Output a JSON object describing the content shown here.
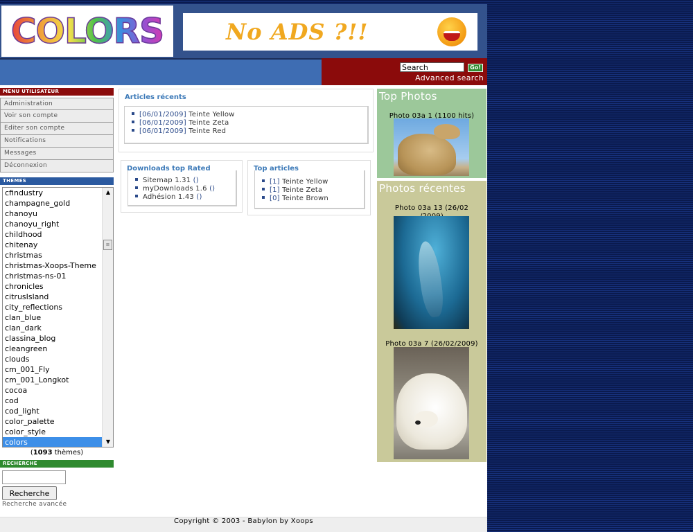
{
  "header": {
    "logo_text": "COLORS",
    "banner_text": "No ADS ?!!",
    "search_value": "Search",
    "go_label": "Go!",
    "advanced_search": "Advanced search"
  },
  "user_menu": {
    "title": "MENU UTILISATEUR",
    "items": [
      "Administration",
      "Voir son compte",
      "Editer son compte",
      "Notifications",
      "Messages",
      "Déconnexion"
    ]
  },
  "themes": {
    "title": "THEMES",
    "items": [
      "cfindustry",
      "champagne_gold",
      "chanoyu",
      "chanoyu_right",
      "childhood",
      "chitenay",
      "christmas",
      "christmas-Xoops-Theme",
      "christmas-ns-01",
      "chronicles",
      "citrusIsland",
      "city_reflections",
      "clan_blue",
      "clan_dark",
      "classina_blog",
      "cleangreen",
      "clouds",
      "cm_001_Fly",
      "cm_001_Longkot",
      "cocoa",
      "cod",
      "cod_light",
      "color_palette",
      "color_style",
      "colors"
    ],
    "selected": "colors",
    "count_prefix": "(",
    "count": "1093",
    "count_suffix": " thèmes)"
  },
  "search_block": {
    "title": "RECHERCHE",
    "button_label": "Recherche",
    "advanced_link": "Recherche avancée"
  },
  "recent_articles": {
    "title": "Articles récents",
    "items": [
      {
        "date": "[06/01/2009]",
        "name": "Teinte Yellow"
      },
      {
        "date": "[06/01/2009]",
        "name": "Teinte Zeta"
      },
      {
        "date": "[06/01/2009]",
        "name": "Teinte Red"
      }
    ]
  },
  "downloads_top": {
    "title": "Downloads top Rated",
    "items": [
      {
        "name": "Sitemap 1.31",
        "rating": "()"
      },
      {
        "name": "myDownloads 1.6",
        "rating": "()"
      },
      {
        "name": "Adhésion 1.43",
        "rating": "()"
      }
    ]
  },
  "top_articles": {
    "title": "Top articles",
    "items": [
      {
        "count": "[1]",
        "name": "Teinte Yellow"
      },
      {
        "count": "[1]",
        "name": "Teinte Zeta"
      },
      {
        "count": "[0]",
        "name": "Teinte Brown"
      }
    ]
  },
  "top_photos": {
    "title": "Top Photos",
    "caption_name": "Photo 03a 1",
    "caption_hits": "(1100 hits)"
  },
  "recent_photos": {
    "title": "Photos récentes",
    "photo1_line1": "Photo 03a 13 (26/02",
    "photo1_line2": "/2009)",
    "photo2_caption": "Photo 03a 7 (26/02/2009)"
  },
  "footer": {
    "copyright": "Copyright © 2003 - Babylon by Xoops"
  },
  "colors": {
    "page_bg": "#0b1c52",
    "header_blue": "#3e6db3",
    "dark_red": "#8b0b0b",
    "top_photos_bg": "#9cc89a",
    "recent_photos_bg": "#c9c99a",
    "link_blue": "#2b4a8a",
    "title_blue": "#3d7ab8"
  }
}
